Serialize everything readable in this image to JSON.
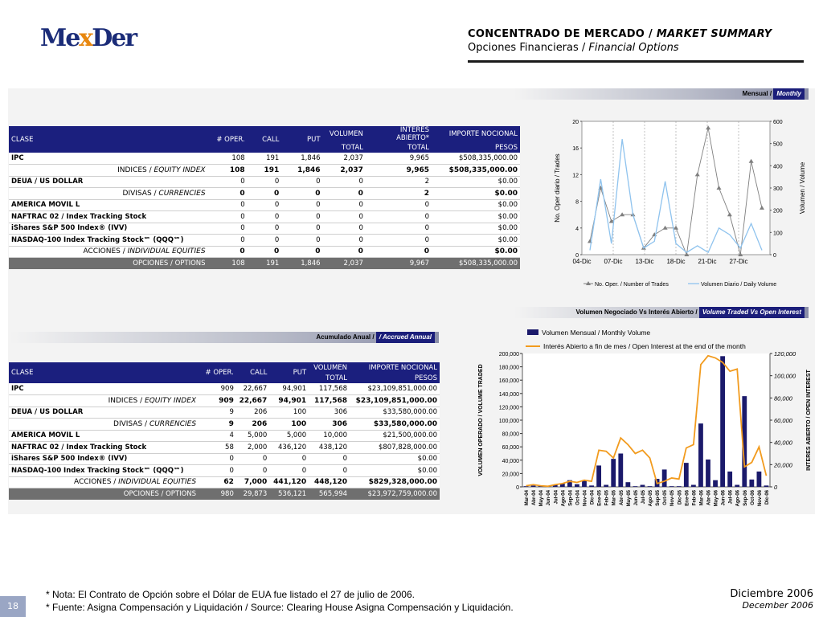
{
  "header": {
    "logo_pre": "Me",
    "logo_x": "x",
    "logo_post": "Der",
    "title_es": "CONCENTRADO DE MERCADO / ",
    "title_en": "MARKET SUMMARY",
    "subtitle_es": "Opciones Financieras / ",
    "subtitle_en": "Financial Options"
  },
  "monthly": {
    "bar_es": "Mensual /",
    "bar_en": "Monthly",
    "columns": [
      "CLASE",
      "# OPER.",
      "CALL",
      "PUT",
      "VOLUMEN",
      "INTERES ABIERTO*",
      "IMPORTE NOCIONAL"
    ],
    "columns2": [
      "TOTAL",
      "TOTAL",
      "PESOS"
    ],
    "rows": [
      {
        "name": "IPC",
        "v": [
          "108",
          "191",
          "1,846",
          "2,037",
          "9,965",
          "$508,335,000.00"
        ]
      },
      {
        "sub_es": "INDICES / ",
        "sub_en": "EQUITY INDEX",
        "v": [
          "108",
          "191",
          "1,846",
          "2,037",
          "9,965",
          "$508,335,000.00"
        ]
      },
      {
        "name": "DEUA / US DOLLAR",
        "v": [
          "0",
          "0",
          "0",
          "0",
          "2",
          "$0.00"
        ]
      },
      {
        "sub_es": "DIVISAS / ",
        "sub_en": "CURRENCIES",
        "v": [
          "0",
          "0",
          "0",
          "0",
          "2",
          "$0.00"
        ]
      },
      {
        "name": "AMERICA MOVIL L",
        "v": [
          "0",
          "0",
          "0",
          "0",
          "0",
          "$0.00"
        ]
      },
      {
        "name": "NAFTRAC 02 / Index Tracking Stock",
        "v": [
          "0",
          "0",
          "0",
          "0",
          "0",
          "$0.00"
        ]
      },
      {
        "name": "iShares S&P 500 Index® (IVV)",
        "v": [
          "0",
          "0",
          "0",
          "0",
          "0",
          "$0.00"
        ]
      },
      {
        "name": "NASDAQ-100 Index Tracking Stock℠ (QQQ℠)",
        "v": [
          "0",
          "0",
          "0",
          "0",
          "0",
          "$0.00"
        ]
      },
      {
        "sub_es": "ACCIONES / ",
        "sub_en": "INDIVIDUAL EQUITIES",
        "v": [
          "0",
          "0",
          "0",
          "0",
          "0",
          "$0.00"
        ]
      },
      {
        "total": "OPCIONES / OPTIONS",
        "v": [
          "108",
          "191",
          "1,846",
          "2,037",
          "9,967",
          "$508,335,000.00"
        ]
      }
    ]
  },
  "annual": {
    "bar_es": "Acumulado Anual /",
    "bar_en": "/ Accrued Annual",
    "columns": [
      "CLASE",
      "# OPER.",
      "CALL",
      "PUT",
      "VOLUMEN",
      "IMPORTE NOCIONAL"
    ],
    "columns2": [
      "TOTAL",
      "PESOS"
    ],
    "rows": [
      {
        "name": "IPC",
        "v": [
          "909",
          "22,667",
          "94,901",
          "117,568",
          "$23,109,851,000.00"
        ]
      },
      {
        "sub_es": "INDICES / ",
        "sub_en": "EQUITY INDEX",
        "v": [
          "909",
          "22,667",
          "94,901",
          "117,568",
          "$23,109,851,000.00"
        ]
      },
      {
        "name": "DEUA / US DOLLAR",
        "v": [
          "9",
          "206",
          "100",
          "306",
          "$33,580,000.00"
        ]
      },
      {
        "sub_es": "DIVISAS / ",
        "sub_en": "CURRENCIES",
        "v": [
          "9",
          "206",
          "100",
          "306",
          "$33,580,000.00"
        ]
      },
      {
        "name": "AMERICA MOVIL L",
        "v": [
          "4",
          "5,000",
          "5,000",
          "10,000",
          "$21,500,000.00"
        ]
      },
      {
        "name": "NAFTRAC 02 / Index Tracking Stock",
        "v": [
          "58",
          "2,000",
          "436,120",
          "438,120",
          "$807,828,000.00"
        ]
      },
      {
        "name": "iShares S&P 500 Index® (IVV)",
        "v": [
          "0",
          "0",
          "0",
          "0",
          "$0.00"
        ]
      },
      {
        "name": "NASDAQ-100 Index Tracking Stock℠ (QQQ℠)",
        "v": [
          "0",
          "0",
          "0",
          "0",
          "$0.00"
        ]
      },
      {
        "sub_es": "ACCIONES / ",
        "sub_en": "INDIVIDUAL EQUITIES",
        "v": [
          "62",
          "7,000",
          "441,120",
          "448,120",
          "$829,328,000.00"
        ]
      },
      {
        "total": "OPCIONES / OPTIONS",
        "v": [
          "980",
          "29,873",
          "536,121",
          "565,994",
          "$23,972,759,000.00"
        ]
      }
    ]
  },
  "chart_data": [
    {
      "type": "line",
      "x_ticks": [
        "04-Dic",
        "07-Dic",
        "13-Dic",
        "18-Dic",
        "21-Dic",
        "27-Dic"
      ],
      "ylabel": "No. Oper diario / Trades",
      "y2label": "Volumen / Volume",
      "ylim": [
        0,
        20
      ],
      "y2lim": [
        0,
        600
      ],
      "yticks": [
        "20",
        "16",
        "12",
        "8",
        "4",
        "0"
      ],
      "y2ticks": [
        "600",
        "500",
        "400",
        "300",
        "200",
        "100",
        "0"
      ],
      "series": [
        {
          "name": "No. Oper. / Number of Trades",
          "color": "#7f7f7f",
          "axis": "left",
          "values": [
            2,
            10,
            5,
            6,
            6,
            1,
            3,
            4,
            4,
            0,
            12,
            19,
            10,
            6,
            0,
            14,
            7
          ]
        },
        {
          "name": "Volumen Diario / Daily Volume",
          "color": "#8fc3ee",
          "axis": "right",
          "values": [
            20,
            340,
            50,
            520,
            180,
            30,
            60,
            330,
            50,
            10,
            40,
            10,
            120,
            90,
            30,
            140,
            20
          ]
        }
      ]
    },
    {
      "type": "bar",
      "title_es": "Volumen Negociado Vs Interés Abierto / ",
      "title_en": "Volume Traded Vs Open Interest",
      "ylabel": "VOLUMEN OPERADO / VOLUME TRADED",
      "y2label": "INTERES ABIERTO / OPEN INTEREST",
      "ylim": [
        0,
        200000
      ],
      "y2lim": [
        0,
        120000
      ],
      "yticks": [
        "200,000",
        "180,000",
        "160,000",
        "140,000",
        "120,000",
        "100,000",
        "80,000",
        "60,000",
        "40,000",
        "20,000",
        "0"
      ],
      "y2ticks": [
        "120,000",
        "100,000",
        "80,000",
        "60,000",
        "40,000",
        "20,000",
        "0"
      ],
      "categories": [
        "Mar-04",
        "Abr-04",
        "May-04",
        "Jun-04",
        "Jul-04",
        "Ago-04",
        "Sep-04",
        "Oct-04",
        "Nov-04",
        "Dic-04",
        "Ene-05",
        "Feb-05",
        "Mar-05",
        "Abr-05",
        "May-05",
        "Jun-05",
        "Jul-05",
        "Ago-05",
        "Sep-05",
        "Oct-05",
        "Nov-05",
        "Dic-05",
        "Ene-06",
        "Feb-06",
        "Mar-06",
        "Abr-06",
        "May-06",
        "Jun-06",
        "Jul-06",
        "Ago-06",
        "Sep-06",
        "Oct-06",
        "Nov-06",
        "Dic-06"
      ],
      "series": [
        {
          "name": "Volumen Mensual / Monthly Volume",
          "color": "#1b1a6b",
          "type": "bar",
          "values": [
            1000,
            2000,
            1500,
            500,
            3000,
            5000,
            10000,
            4000,
            10000,
            2000,
            32000,
            3000,
            42000,
            50000,
            7000,
            1000,
            3000,
            1000,
            12000,
            26000,
            1000,
            1000,
            36000,
            3000,
            95000,
            41000,
            10000,
            196000,
            23000,
            3000,
            136000,
            11000,
            23000,
            2000
          ]
        },
        {
          "name": "Interés Abierto a fin de mes / Open Interest at the end of the month",
          "color": "#f29b1e",
          "type": "line",
          "values": [
            1000,
            2000,
            1000,
            500,
            2000,
            3000,
            5000,
            4000,
            6000,
            5000,
            33000,
            32000,
            26000,
            44000,
            38000,
            30000,
            33000,
            26000,
            3000,
            5000,
            8000,
            7000,
            35000,
            38000,
            110000,
            118000,
            116000,
            112000,
            104000,
            106000,
            18000,
            22000,
            36000,
            10000
          ]
        }
      ]
    }
  ],
  "footer": {
    "note": "* Nota: El Contrato de Opción sobre el Dólar de EUA  fue listado el 27 de julio de 2006.",
    "source": "* Fuente: Asigna Compensación y Liquidación / Source: Clearing House Asigna Compensación y Liquidación.",
    "page": "18",
    "date_es": "Diciembre 2006",
    "date_en": "December 2006"
  }
}
